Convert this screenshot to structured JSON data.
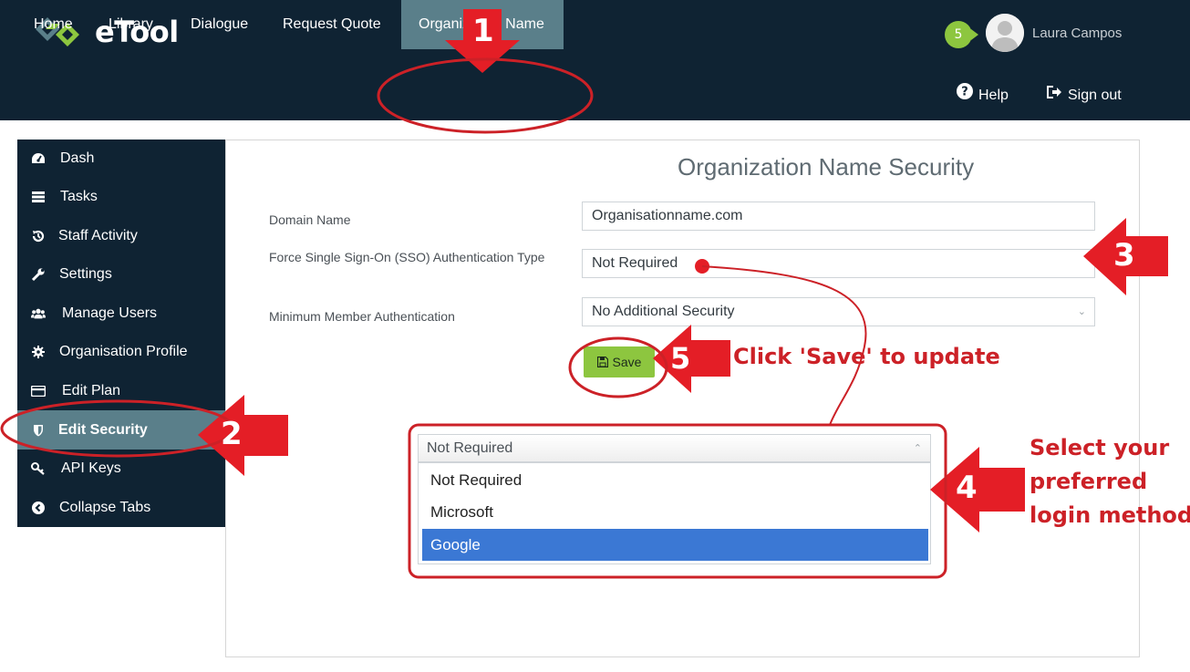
{
  "app": {
    "logo_text": "eTool",
    "notification_count": "5",
    "user_name": "Laura Campos"
  },
  "nav": {
    "items": [
      "Home",
      "Library",
      "Dialogue",
      "Request Quote",
      "Organization Name"
    ],
    "active": "Organization Name",
    "help": "Help",
    "sign_out": "Sign out"
  },
  "sidebar": {
    "items": [
      {
        "label": "Dash",
        "icon": "dashboard-icon"
      },
      {
        "label": "Tasks",
        "icon": "tasks-icon"
      },
      {
        "label": "Staff Activity",
        "icon": "history-icon"
      },
      {
        "label": "Settings",
        "icon": "wrench-icon"
      },
      {
        "label": "Manage Users",
        "icon": "users-icon"
      },
      {
        "label": "Organisation Profile",
        "icon": "gear-icon"
      },
      {
        "label": "Edit Plan",
        "icon": "credit-card-icon"
      },
      {
        "label": "Edit Security",
        "icon": "shield-icon"
      },
      {
        "label": "API Keys",
        "icon": "key-icon"
      },
      {
        "label": "Collapse Tabs",
        "icon": "chevron-left-circle-icon"
      }
    ],
    "active": "Edit Security"
  },
  "form": {
    "title": "Organization Name Security",
    "domain_label": "Domain Name",
    "domain_value": "Organisationname.com",
    "sso_label": "Force Single Sign-On (SSO) Authentication Type",
    "sso_value": "Not Required",
    "min_auth_label": "Minimum Member Authentication",
    "min_auth_value": "No Additional Security",
    "save_label": "Save"
  },
  "dropdown": {
    "current": "Not Required",
    "options": [
      "Not Required",
      "Microsoft",
      "Google"
    ],
    "highlighted": "Google"
  },
  "annotations": {
    "step1": "1",
    "step2": "2",
    "step3": "3",
    "step4": "4",
    "step5": "5",
    "save_hint": "Click 'Save' to update",
    "login_hint_line1": "Select your",
    "login_hint_line2": "preferred",
    "login_hint_line3": "login method",
    "color": "#cc2127",
    "arrow_color": "#e41e26"
  },
  "colors": {
    "header_bg": "#0f2333",
    "active_tab": "#5a7f8a",
    "accent_green": "#8dc63f",
    "selection_blue": "#3b78d4"
  }
}
